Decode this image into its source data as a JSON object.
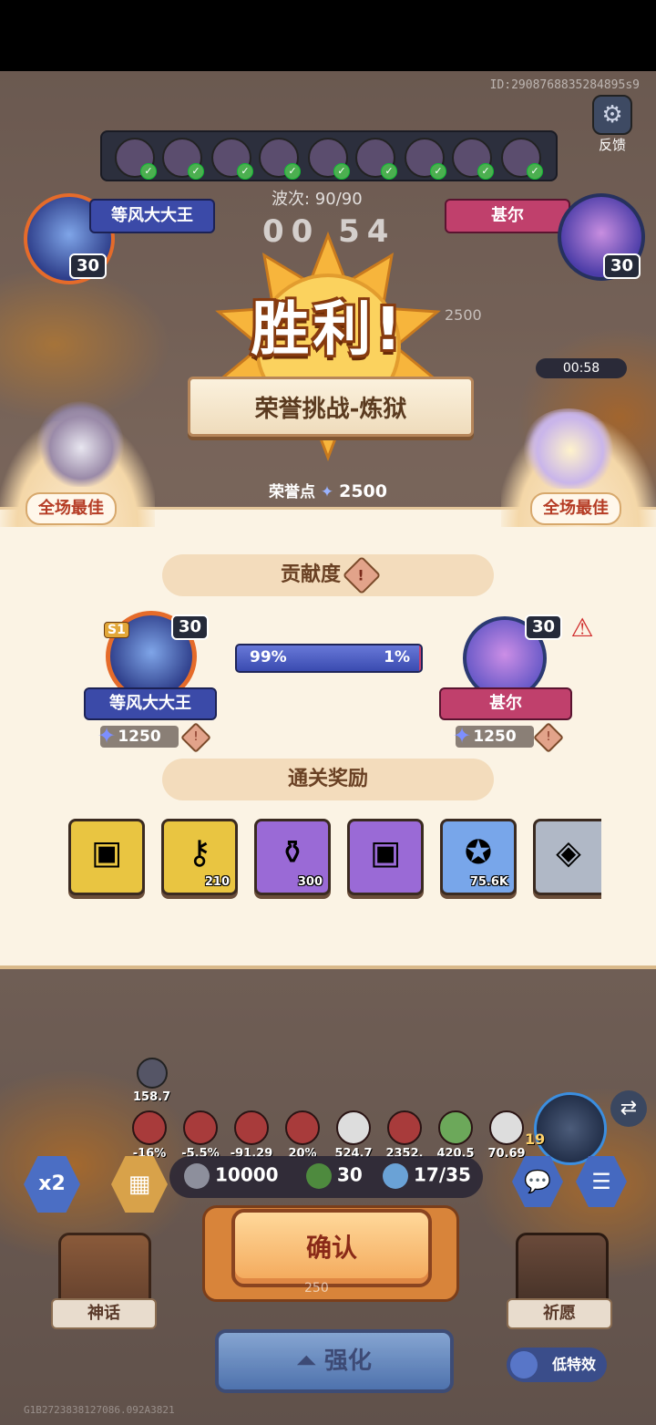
{
  "top": {
    "user_id": "ID:2908768835284895s9",
    "feedback_label": "反馈",
    "wave_text": "波次: 90/90",
    "timer_text": "00 54",
    "faded_score": "2500",
    "countdown": "00:58"
  },
  "players": {
    "p1": {
      "name": "等风大大王",
      "level": "30",
      "season": "S1",
      "points": "1250"
    },
    "p2": {
      "name": "甚尔",
      "level": "30",
      "points": "1250"
    }
  },
  "result": {
    "title": "胜利!",
    "mode": "荣誉挑战-炼狱",
    "mvp_label": "全场最佳",
    "honor_label": "荣誉点",
    "honor_value": "2500"
  },
  "contribution": {
    "title": "贡献度",
    "p1_percent": "99%",
    "p2_percent": "1%",
    "p1_fraction": 0.99
  },
  "rewards": {
    "title": "通关奖励",
    "items": [
      {
        "icon": "chest-icon",
        "qty": ""
      },
      {
        "icon": "key-icon",
        "qty": "210"
      },
      {
        "icon": "potion-icon",
        "qty": "300"
      },
      {
        "icon": "purple-chest-icon",
        "qty": ""
      },
      {
        "icon": "gold-coin-icon",
        "qty": "75.6K"
      },
      {
        "icon": "silver-emblem-icon",
        "qty": ""
      }
    ]
  },
  "hud": {
    "stat_top": "158.7",
    "stats": [
      "-16%",
      "-5.5%",
      "-91.29",
      "20%",
      "524.7",
      "2352.",
      "420.5",
      "70.69"
    ],
    "resources": {
      "silver": "10000",
      "clover": "30",
      "units": "17/35"
    },
    "speed_label": "x2",
    "hero_level": "19",
    "myth_label": "神话",
    "wish_label": "祈愿",
    "confirm_label": "确认",
    "under_confirm": "250",
    "upgrade_label": "强化",
    "low_fx_label": "低特效",
    "build_id": "G1B2723838127086.092A3821"
  },
  "colors": {
    "team_blue": "#3b4aa8",
    "team_pink": "#c0406c",
    "panel_bg": "#fbf3e4",
    "confirm": "#f3a85a"
  }
}
